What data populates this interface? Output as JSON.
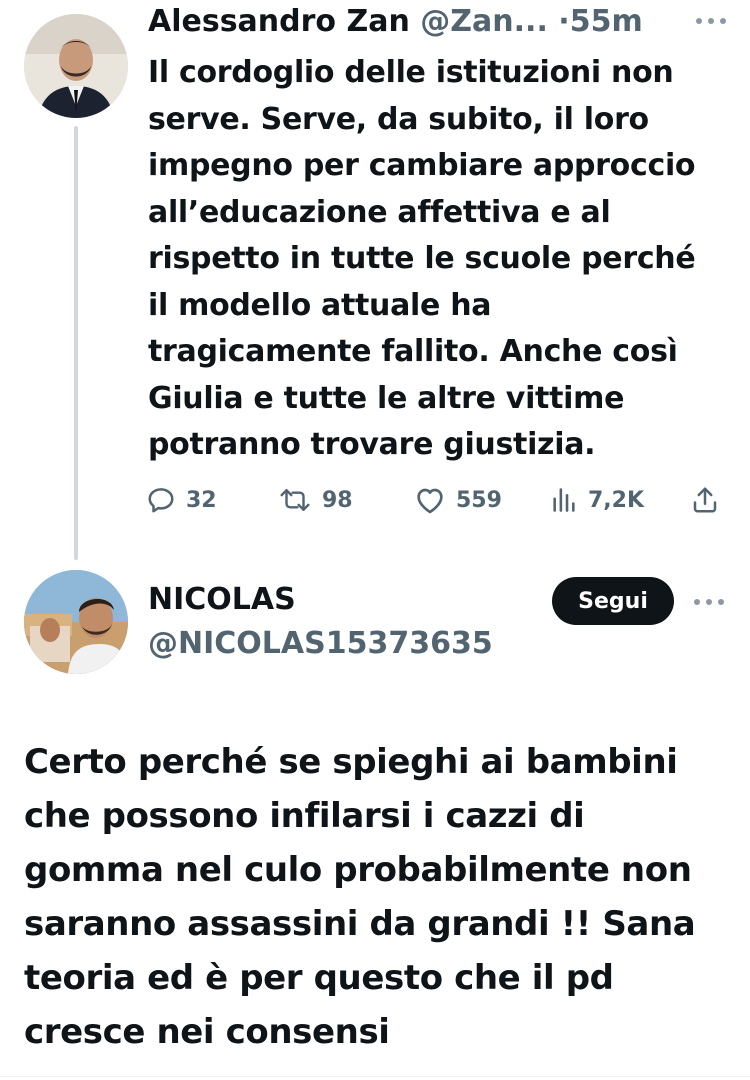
{
  "tweet1": {
    "author_name": "Alessandro Zan",
    "author_handle": "@Zan...",
    "separator": "·",
    "time": "55m",
    "text_lines": [
      "Il cordoglio delle istituzioni non",
      "serve. Serve, da subito, il loro",
      "impegno per cambiare approccio",
      "all’educazione affettiva e al",
      "rispetto in tutte le scuole perché",
      "il modello attuale ha",
      "tragicamente fallito. Anche così",
      "Giulia e tutte le altre vittime",
      "potranno trovare giustizia."
    ],
    "actions": {
      "replies": "32",
      "retweets": "98",
      "likes": "559",
      "views": "7,2K"
    }
  },
  "tweet2": {
    "author_name": "NICOLAS",
    "author_handle": "@NICOLAS15373635",
    "follow_label": "Segui",
    "text_lines": [
      "Certo perché se spieghi ai bambini",
      "che possono infilarsi i cazzi di",
      "gomma nel culo probabilmente non",
      "saranno assassini da grandi !! Sana",
      "teoria ed è per questo che il pd",
      "cresce nei consensi"
    ]
  },
  "icons": [
    "reply-icon",
    "retweet-icon",
    "like-icon",
    "views-icon",
    "share-icon",
    "more-icon"
  ],
  "colors": {
    "text": "#0f1419",
    "secondary": "#536471",
    "thread_line": "#cfd9de",
    "button_bg": "#0f1419"
  }
}
